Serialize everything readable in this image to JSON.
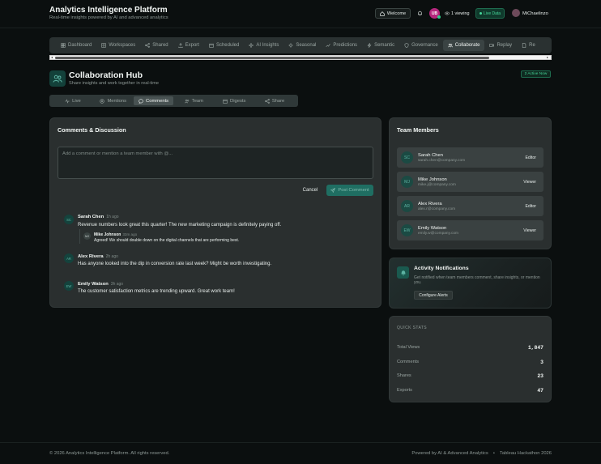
{
  "header": {
    "title": "Analytics Intelligence Platform",
    "subtitle": "Real-time insights powered by AI and advanced analytics",
    "welcome_label": "Welcome",
    "user_initials": "UB",
    "viewing_label": "1 viewing",
    "live_label": "Live Data",
    "user_name": "MiChaelinzo"
  },
  "nav_tabs": [
    {
      "label": "Dashboard",
      "icon": "grid-icon"
    },
    {
      "label": "Workspaces",
      "icon": "squares-icon"
    },
    {
      "label": "Shared",
      "icon": "share-icon"
    },
    {
      "label": "Export",
      "icon": "export-icon"
    },
    {
      "label": "Scheduled",
      "icon": "calendar-icon"
    },
    {
      "label": "AI Insights",
      "icon": "sparkle-icon"
    },
    {
      "label": "Seasonal",
      "icon": "sun-icon"
    },
    {
      "label": "Predictions",
      "icon": "trend-icon"
    },
    {
      "label": "Semantic",
      "icon": "bolt-icon"
    },
    {
      "label": "Governance",
      "icon": "shield-icon"
    },
    {
      "label": "Collaborate",
      "icon": "users-icon",
      "active": true
    },
    {
      "label": "Replay",
      "icon": "video-icon"
    },
    {
      "label": "Re",
      "icon": "doc-icon"
    }
  ],
  "hub": {
    "title": "Collaboration Hub",
    "subtitle": "Share insights and work together in real-time",
    "active_badge": "2 Active Now"
  },
  "sub_tabs": [
    {
      "label": "Live",
      "icon": "pulse-icon"
    },
    {
      "label": "Mentions",
      "icon": "at-icon"
    },
    {
      "label": "Comments",
      "icon": "comment-icon",
      "active": true
    },
    {
      "label": "Team",
      "icon": "users-icon"
    },
    {
      "label": "Digests",
      "icon": "calendar-icon"
    },
    {
      "label": "Share",
      "icon": "share-icon"
    }
  ],
  "comments_panel": {
    "title": "Comments & Discussion",
    "placeholder": "Add a comment or mention a team member with @...",
    "cancel_label": "Cancel",
    "post_label": "Post Comment",
    "comments": [
      {
        "initials": "SC",
        "name": "Sarah Chen",
        "time": "1h ago",
        "text": "Revenue numbers look great this quarter! The new marketing campaign is definitely paying off."
      },
      {
        "initials": "AR",
        "name": "Alex Rivera",
        "time": "2h ago",
        "text": "Has anyone looked into the dip in conversion rate last week? Might be worth investigating."
      },
      {
        "initials": "EW",
        "name": "Emily Watson",
        "time": "3h ago",
        "text": "The customer satisfaction metrics are trending upward. Great work team!"
      }
    ],
    "reply": {
      "initials": "MJ",
      "name": "Mike Johnson",
      "time": "33m ago",
      "text": "Agreed! We should double down on the digital channels that are performing best."
    }
  },
  "team": {
    "title": "Team Members",
    "members": [
      {
        "initials": "SC",
        "name": "Sarah Chen",
        "email": "sarah.chen@company.com",
        "role": "Editor"
      },
      {
        "initials": "MJ",
        "name": "Mike Johnson",
        "email": "mike.j@company.com",
        "role": "Viewer"
      },
      {
        "initials": "AR",
        "name": "Alex Rivera",
        "email": "alex.r@company.com",
        "role": "Editor"
      },
      {
        "initials": "EW",
        "name": "Emily Watson",
        "email": "emily.w@company.com",
        "role": "Viewer"
      }
    ]
  },
  "notifications": {
    "title": "Activity Notifications",
    "text": "Get notified when team members comment, share insights, or mention you.",
    "button_label": "Configure Alerts"
  },
  "stats": {
    "heading": "QUICK STATS",
    "items": [
      {
        "label": "Total Views",
        "value": "1,847"
      },
      {
        "label": "Comments",
        "value": "3"
      },
      {
        "label": "Shares",
        "value": "23"
      },
      {
        "label": "Exports",
        "value": "47"
      }
    ]
  },
  "footer": {
    "copyright": "© 2026 Analytics Intelligence Platform. All rights reserved.",
    "powered": "Powered by AI & Advanced Analytics",
    "separator": "•",
    "event": "Tableau Hackathon 2026"
  },
  "colors": {
    "background": "#0b0f0f",
    "panel": "#2a2f2f",
    "accent": "#1f6e62",
    "live_green": "#45d79a",
    "avatar_pink": "#b5277d"
  }
}
